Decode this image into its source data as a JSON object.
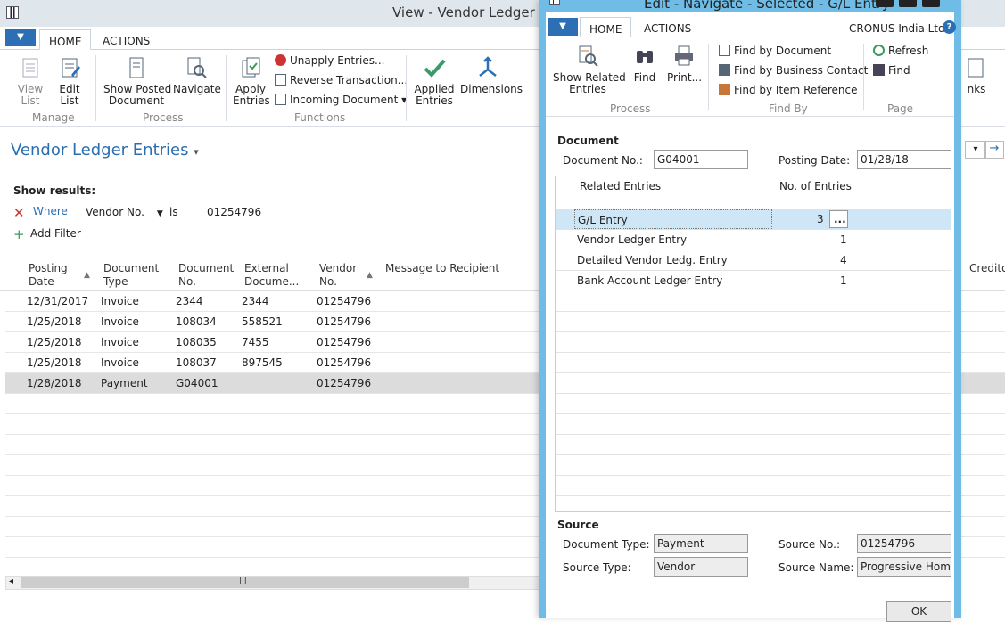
{
  "back_window": {
    "title": "View - Vendor Ledger En",
    "menu_icon": "menu-dropdown-icon",
    "tabs": [
      "HOME",
      "ACTIONS"
    ],
    "ribbon": {
      "view_list": "View\nList",
      "edit_list": "Edit\nList",
      "group_manage": "Manage",
      "show_posted": "Show Posted\nDocument",
      "navigate": "Navigate",
      "group_process": "Process",
      "apply_entries": "Apply\nEntries",
      "unapply": "Unapply Entries...",
      "reverse": "Reverse Transaction...",
      "incoming": "Incoming Document",
      "group_functions": "Functions",
      "applied_entries": "Applied\nEntries",
      "dimensions": "Dimensions",
      "links": "nks"
    },
    "page_title": "Vendor Ledger Entries",
    "show_results": "Show results:",
    "filter": {
      "where": "Where",
      "field": "Vendor No.",
      "op": "is",
      "value": "01254796"
    },
    "add_filter": "Add Filter",
    "columns": [
      "Posting\nDate",
      "Document\nType",
      "Document\nNo.",
      "External\nDocume...",
      "Vendor\nNo.",
      "Message to Recipient",
      "Credito"
    ],
    "rows": [
      {
        "date": "12/31/2017",
        "type": "Invoice",
        "doc": "2344",
        "ext": "2344",
        "vendor": "01254796"
      },
      {
        "date": "1/25/2018",
        "type": "Invoice",
        "doc": "108034",
        "ext": "558521",
        "vendor": "01254796"
      },
      {
        "date": "1/25/2018",
        "type": "Invoice",
        "doc": "108035",
        "ext": "7455",
        "vendor": "01254796"
      },
      {
        "date": "1/25/2018",
        "type": "Invoice",
        "doc": "108037",
        "ext": "897545",
        "vendor": "01254796"
      },
      {
        "date": "1/28/2018",
        "type": "Payment",
        "doc": "G04001",
        "ext": "",
        "vendor": "01254796"
      }
    ],
    "scroll_label": "III"
  },
  "dialog": {
    "title": "Edit - Navigate - Selected - G/L Entry",
    "company": "CRONUS India Ltd.",
    "tabs": [
      "HOME",
      "ACTIONS"
    ],
    "ribbon": {
      "show_related": "Show Related\nEntries",
      "find": "Find",
      "print": "Print...",
      "group_process": "Process",
      "find_by_document": "Find by Document",
      "find_by_contact": "Find by Business Contact",
      "find_by_item": "Find by Item Reference",
      "group_findby": "Find By",
      "refresh": "Refresh",
      "find_small": "Find",
      "group_page": "Page"
    },
    "document": {
      "section": "Document",
      "doc_no_label": "Document No.:",
      "doc_no": "G04001",
      "posting_label": "Posting Date:",
      "posting": "01/28/18"
    },
    "grid": {
      "col_related": "Related Entries",
      "col_count": "No. of Entries",
      "rows": [
        {
          "name": "G/L Entry",
          "count": "3"
        },
        {
          "name": "Vendor Ledger Entry",
          "count": "1"
        },
        {
          "name": "Detailed Vendor Ledg. Entry",
          "count": "4"
        },
        {
          "name": "Bank Account Ledger Entry",
          "count": "1"
        }
      ],
      "ellipsis": "..."
    },
    "source": {
      "section": "Source",
      "doc_type_label": "Document Type:",
      "doc_type": "Payment",
      "src_no_label": "Source No.:",
      "src_no": "01254796",
      "src_type_label": "Source Type:",
      "src_type": "Vendor",
      "src_name_label": "Source Name:",
      "src_name": "Progressive Hom..."
    },
    "ok": "OK"
  },
  "colors": {
    "accent": "#2c6fb5",
    "dialog_frame": "#6fbde6",
    "selected_row": "#cfe6f7",
    "title_blue": "#2a6fb0"
  }
}
